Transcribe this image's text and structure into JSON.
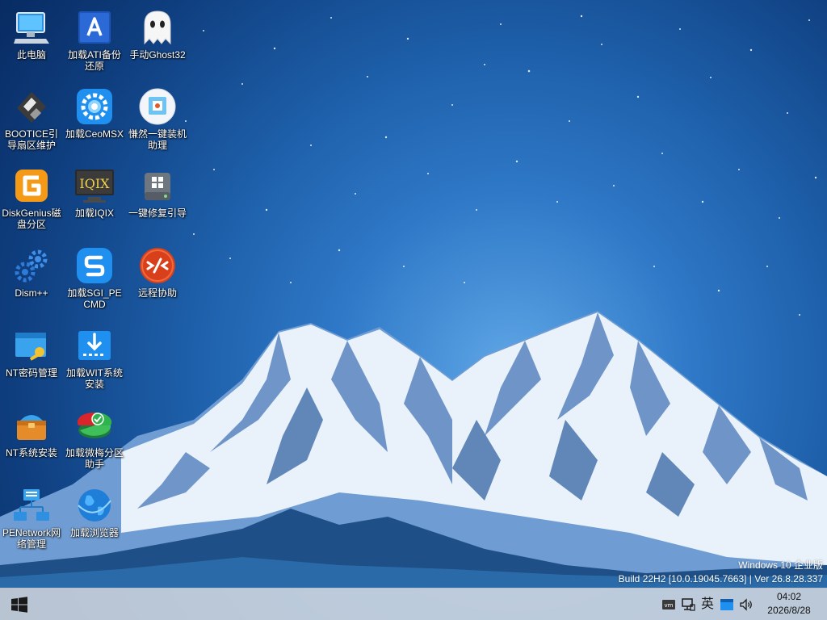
{
  "desktop": {
    "icons": [
      {
        "label": "此电脑",
        "icon": "computer-icon"
      },
      {
        "label": "加载ATI备份还原",
        "icon": "acronis-icon"
      },
      {
        "label": "手动Ghost32",
        "icon": "ghost-icon"
      },
      {
        "label": "BOOTICE引导扇区维护",
        "icon": "floppy-disk-icon"
      },
      {
        "label": "加载CeoMSX",
        "icon": "gear-swirl-icon"
      },
      {
        "label": "慊然一键装机助理",
        "icon": "installer-helper-icon"
      },
      {
        "label": "DiskGenius磁盘分区",
        "icon": "diskgenius-icon"
      },
      {
        "label": "加载IQIX",
        "icon": "iqix-monitor-icon",
        "badge_text": "IQIX"
      },
      {
        "label": "一键修复引导",
        "icon": "windows-drive-icon"
      },
      {
        "label": "Dism++",
        "icon": "gears-icon"
      },
      {
        "label": "加载SGI_PECMD",
        "icon": "sgi-s-icon"
      },
      {
        "label": "远程协助",
        "icon": "remote-assist-icon"
      },
      {
        "label": "NT密码管理",
        "icon": "window-key-icon"
      },
      {
        "label": "加载WIT系统安装",
        "icon": "download-box-icon"
      },
      {
        "label": "NT系统安装",
        "icon": "toolbox-icon"
      },
      {
        "label": "加载微梅分区助手",
        "icon": "partition-pie-icon"
      },
      {
        "label": "PENetwork网络管理",
        "icon": "network-icon"
      },
      {
        "label": "加载浏览器",
        "icon": "globe-icon"
      }
    ]
  },
  "watermark": {
    "line1": "Windows 10 企业版",
    "line2": "Build 22H2 [10.0.19045.7663] | Ver 26.8.28.337"
  },
  "taskbar": {
    "start_icon": "windows-logo-icon",
    "tray": {
      "vm_icon": "vmware-tray-icon",
      "network_icon": "network-tray-icon",
      "ime_label": "英",
      "action_icon": "action-center-icon",
      "volume_icon": "volume-icon"
    },
    "clock": {
      "time": "04:02",
      "date": "2026/8/28"
    }
  },
  "colors": {
    "sky_top": "#082b62",
    "sky_glow": "#5fa7e6",
    "snow": "#eef4fb",
    "taskbar": "#d2d8e0"
  }
}
